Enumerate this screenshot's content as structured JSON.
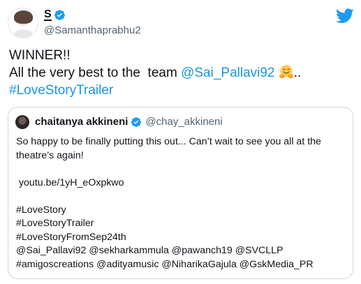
{
  "author": {
    "display_name": "S",
    "handle": "@Samanthaprabhu2"
  },
  "tweet": {
    "line1": "WINNER!!",
    "line2_prefix": "All the very best to the  team ",
    "mention": "@Sai_Pallavi92",
    "line2_suffix": "..",
    "hashtag": "#LoveStoryTrailer"
  },
  "quoted_tweet": {
    "display_name": "chaitanya akkineni",
    "handle": "@chay_akkineni",
    "lines": [
      "So happy to be finally putting this out... Can’t wait to see you all at the",
      "theatre’s again!",
      "",
      " youtu.be/1yH_eOxpkwo",
      "",
      "#LoveStory",
      "#LoveStoryTrailer",
      "#LoveStoryFromSep24th",
      "@Sai_Pallavi92 @sekharkammula @pawanch19 @SVCLLP",
      "#amigoscreations @adityamusic @NiharikaGajula @GskMedia_PR"
    ]
  },
  "icons": {
    "verified": "verified-badge-icon",
    "logo": "twitter-bird-icon",
    "emoji": "hugging-face-emoji"
  },
  "colors": {
    "accent": "#1b95e0",
    "verified": "#1d9bf0",
    "muted": "#536471",
    "border": "#cfd9de"
  }
}
